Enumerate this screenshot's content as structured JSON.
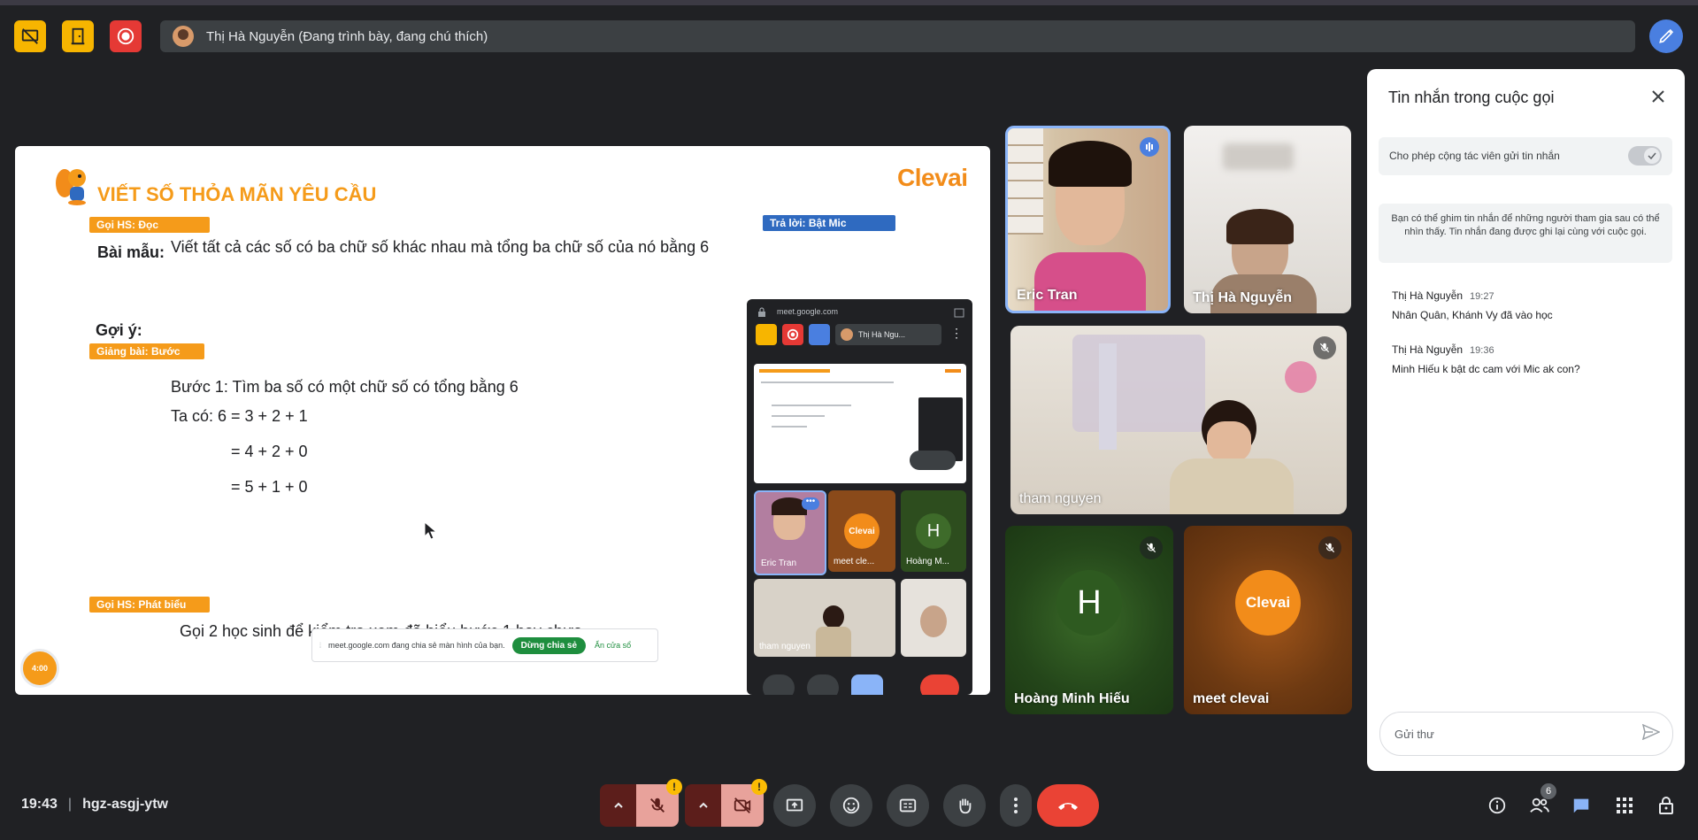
{
  "presenter_bar": {
    "text": "Thị Hà Nguyễn (Đang trình bày, đang chú thích)"
  },
  "slide": {
    "title": "VIẾT SỐ THỎA MÃN YÊU CẦU",
    "brand": "Clevai",
    "tag_goi_doc": "Gọi HS: Đọc",
    "tag_tra_loi": "Trả lời: Bật Mic",
    "bai_mau_label": "Bài mẫu:",
    "bai_mau_text": "Viết tất cả các số có ba chữ số khác nhau mà tổng ba chữ số của nó bằng 6",
    "goi_y_label": "Gợi ý:",
    "tag_giang_bai": "Giảng bài: Bước giải",
    "step1": "Bước 1: Tìm ba số có một chữ số có tổng bằng 6",
    "line1": "Ta có: 6 = 3 + 2 + 1",
    "line2": "= 4 + 2 + 0",
    "line3": "= 5 + 1 + 0",
    "tag_phat_bieu": "Gọi HS: Phát biểu",
    "last_line": "Gọi 2 học sinh để kiểm tra xem đã hiểu bước 1 hay chưa",
    "timer": "4:00"
  },
  "share_notice": {
    "text": "meet.google.com đang chia sẻ màn hình của bạn.",
    "stop_button": "Dừng chia sẻ",
    "hide_link": "Ẩn cửa sổ"
  },
  "pip": {
    "url": "meet.google.com",
    "presenter": "Thị Hà Ngu...",
    "tiles": [
      {
        "name": "Eric Tran"
      },
      {
        "name": "meet cle..."
      },
      {
        "name": "Hoàng M..."
      },
      {
        "name": "tham nguyen"
      }
    ],
    "clevai_badge": "Clevai",
    "h_letter": "H"
  },
  "participants": [
    {
      "name": "Eric Tran"
    },
    {
      "name": "Thị Hà Nguyễn"
    },
    {
      "name": "tham nguyen"
    },
    {
      "name": "Hoàng Minh Hiếu",
      "letter": "H"
    },
    {
      "name": "meet clevai",
      "badge": "Clevai"
    }
  ],
  "chat": {
    "title": "Tin nhắn trong cuộc gọi",
    "toggle_label": "Cho phép cộng tác viên gửi tin nhắn",
    "info": "Bạn có thể ghim tin nhắn để những người tham gia sau có thể nhìn thấy. Tin nhắn đang được ghi lại cùng với cuộc gọi.",
    "messages": [
      {
        "sender": "Thị Hà Nguyễn",
        "time": "19:27",
        "text": "Nhân Quân, Khánh Vy đã vào học"
      },
      {
        "sender": "Thị Hà Nguyễn",
        "time": "19:36",
        "text": "Minh Hiếu k bật dc cam với Mic ak con?"
      }
    ],
    "input_placeholder": "Gửi thư"
  },
  "bottom": {
    "time": "19:43",
    "meeting_code": "hgz-asgj-ytw",
    "people_count": "6"
  },
  "colors": {
    "accent_blue": "#4a7fe0",
    "end_call_red": "#ea4335",
    "slide_orange": "#f59b1a",
    "record_red": "#e53935",
    "presenting_yellow": "#f7b500"
  }
}
